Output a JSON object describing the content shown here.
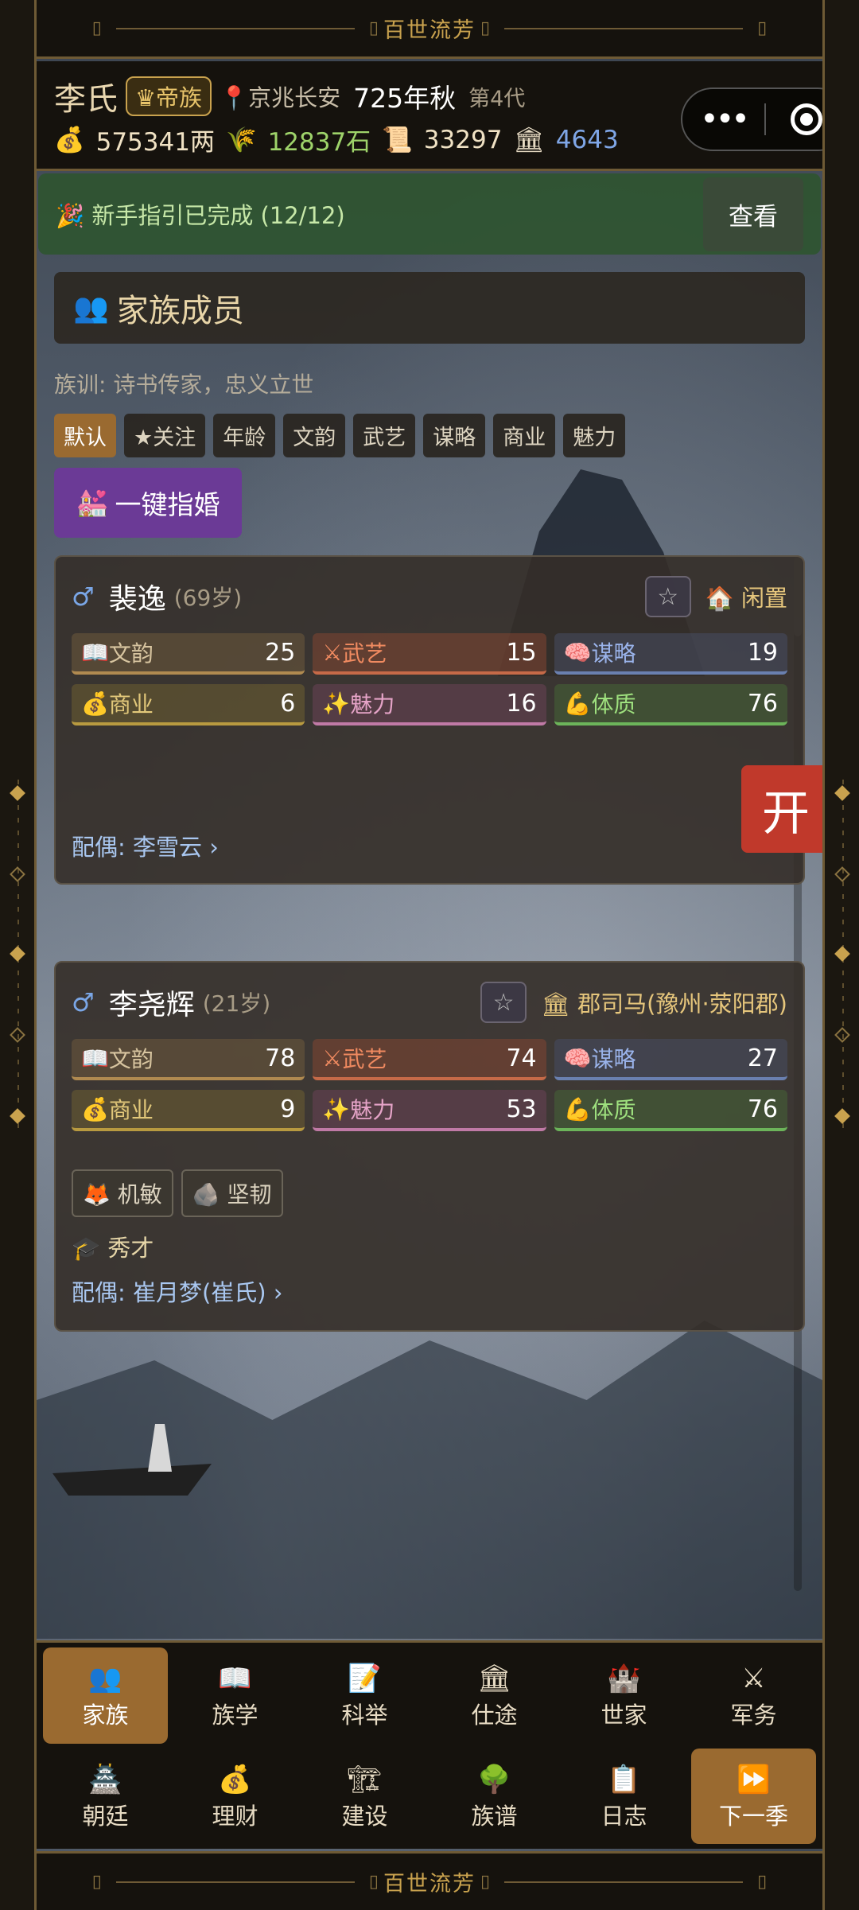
{
  "app": {
    "banner_title": "百世流芳"
  },
  "status": {
    "clan_name": "李氏",
    "rank_badge": "帝族",
    "location": "京兆长安",
    "date": "725年秋",
    "generation": "第4代",
    "silver": "575341两",
    "grain": "12837石",
    "scroll": "33297",
    "hall": "4643"
  },
  "guide": {
    "text": "新手指引已完成 (12/12)",
    "button": "查看"
  },
  "section": {
    "title": "家族成员",
    "motto": "族训: 诗书传家，忠义立世"
  },
  "filters": [
    "默认",
    "★关注",
    "年龄",
    "文韵",
    "武艺",
    "谋略",
    "商业",
    "魅力"
  ],
  "marry_button": "一键指婚",
  "float_button": "开",
  "members": [
    {
      "name": "裴逸",
      "age": "(69岁)",
      "role": "闲置",
      "stats": {
        "wen": {
          "label": "文韵",
          "value": "25"
        },
        "wu": {
          "label": "武艺",
          "value": "15"
        },
        "mou": {
          "label": "谋略",
          "value": "19"
        },
        "shang": {
          "label": "商业",
          "value": "6"
        },
        "mei": {
          "label": "魅力",
          "value": "16"
        },
        "ti": {
          "label": "体质",
          "value": "76"
        }
      },
      "spouse": "配偶: 李雪云 ›"
    },
    {
      "name": "李尧辉",
      "age": "(21岁)",
      "role": "郡司马(豫州·荥阳郡)",
      "stats": {
        "wen": {
          "label": "文韵",
          "value": "78"
        },
        "wu": {
          "label": "武艺",
          "value": "74"
        },
        "mou": {
          "label": "谋略",
          "value": "27"
        },
        "shang": {
          "label": "商业",
          "value": "9"
        },
        "mei": {
          "label": "魅力",
          "value": "53"
        },
        "ti": {
          "label": "体质",
          "value": "76"
        }
      },
      "traits": [
        "机敏",
        "坚韧"
      ],
      "title": "秀才",
      "spouse": "配偶: 崔月梦(崔氏) ›"
    }
  ],
  "nav": [
    {
      "label": "家族",
      "icon": "family-icon"
    },
    {
      "label": "族学",
      "icon": "book-icon"
    },
    {
      "label": "科举",
      "icon": "exam-icon"
    },
    {
      "label": "仕途",
      "icon": "official-icon"
    },
    {
      "label": "世家",
      "icon": "castle-icon"
    },
    {
      "label": "军务",
      "icon": "swords-icon"
    },
    {
      "label": "朝廷",
      "icon": "court-icon"
    },
    {
      "label": "理财",
      "icon": "money-icon"
    },
    {
      "label": "建设",
      "icon": "crane-icon"
    },
    {
      "label": "族谱",
      "icon": "tree-icon"
    },
    {
      "label": "日志",
      "icon": "log-icon"
    },
    {
      "label": "下一季",
      "icon": "fast-forward-icon"
    }
  ]
}
